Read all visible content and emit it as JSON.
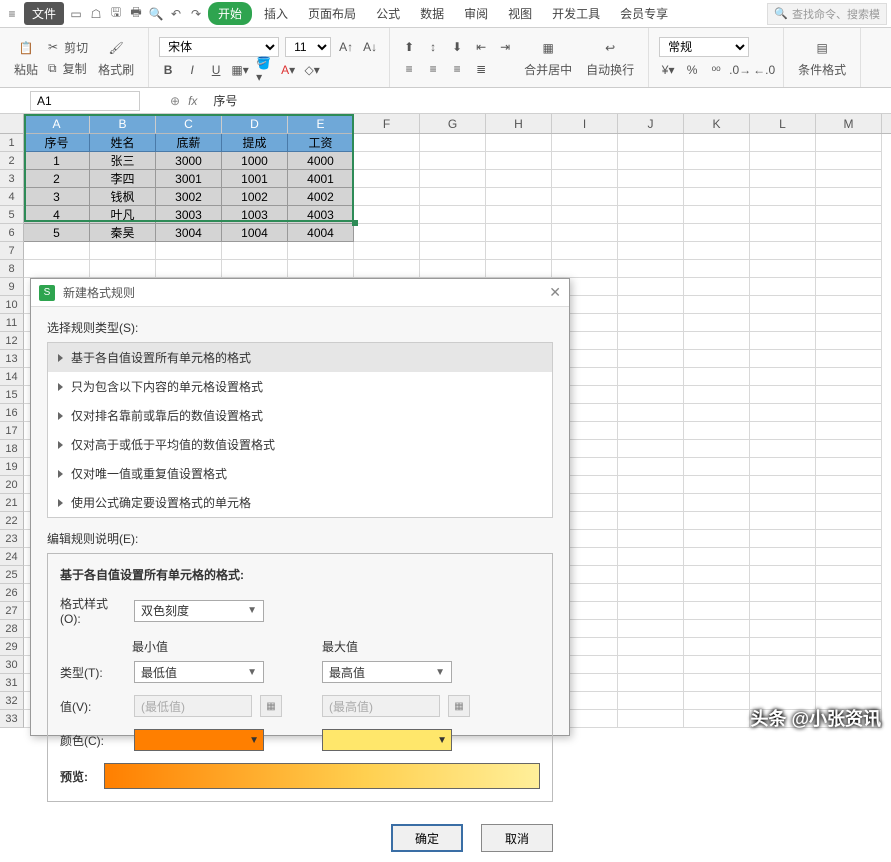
{
  "menu": {
    "file": "文件",
    "start": "开始",
    "items": [
      "插入",
      "页面布局",
      "公式",
      "数据",
      "审阅",
      "视图",
      "开发工具",
      "会员专享"
    ],
    "search_placeholder": "查找命令、搜索模"
  },
  "ribbon": {
    "paste": "粘贴",
    "cut": "剪切",
    "copy": "复制",
    "format_painter": "格式刷",
    "font": "宋体",
    "font_size": "11",
    "merge": "合并居中",
    "autowrap": "自动换行",
    "numfmt": "常规",
    "condfmt": "条件格式"
  },
  "formula": {
    "name": "A1",
    "value": "序号"
  },
  "grid": {
    "cols": [
      "A",
      "B",
      "C",
      "D",
      "E",
      "F",
      "G",
      "H",
      "I",
      "J",
      "K",
      "L",
      "M"
    ],
    "headers": [
      "序号",
      "姓名",
      "底薪",
      "提成",
      "工资"
    ],
    "rows": [
      [
        "1",
        "张三",
        "3000",
        "1000",
        "4000"
      ],
      [
        "2",
        "李四",
        "3001",
        "1001",
        "4001"
      ],
      [
        "3",
        "钱枫",
        "3002",
        "1002",
        "4002"
      ],
      [
        "4",
        "叶凡",
        "3003",
        "1003",
        "4003"
      ],
      [
        "5",
        "秦昊",
        "3004",
        "1004",
        "4004"
      ]
    ]
  },
  "dialog": {
    "title": "新建格式规则",
    "rule_type_label": "选择规则类型(S):",
    "rules": [
      "基于各自值设置所有单元格的格式",
      "只为包含以下内容的单元格设置格式",
      "仅对排名靠前或靠后的数值设置格式",
      "仅对高于或低于平均值的数值设置格式",
      "仅对唯一值或重复值设置格式",
      "使用公式确定要设置格式的单元格"
    ],
    "edit_label": "编辑规则说明(E):",
    "section_title": "基于各自值设置所有单元格的格式:",
    "format_style_label": "格式样式(O):",
    "format_style_value": "双色刻度",
    "min_label": "最小值",
    "max_label": "最大值",
    "type_label": "类型(T):",
    "type_min": "最低值",
    "type_max": "最高值",
    "value_label": "值(V):",
    "value_min_placeholder": "(最低值)",
    "value_max_placeholder": "(最高值)",
    "color_label": "颜色(C):",
    "preview_label": "预览:",
    "ok": "确定",
    "cancel": "取消",
    "min_color": "#ff7f00",
    "max_color": "#ffe76b"
  },
  "watermark": "头条 @小张资讯",
  "chart_data": {
    "type": "table",
    "title": "",
    "columns": [
      "序号",
      "姓名",
      "底薪",
      "提成",
      "工资"
    ],
    "rows": [
      [
        1,
        "张三",
        3000,
        1000,
        4000
      ],
      [
        2,
        "李四",
        3001,
        1001,
        4001
      ],
      [
        3,
        "钱枫",
        3002,
        1002,
        4002
      ],
      [
        4,
        "叶凡",
        3003,
        1003,
        4003
      ],
      [
        5,
        "秦昊",
        3004,
        1004,
        4004
      ]
    ]
  }
}
